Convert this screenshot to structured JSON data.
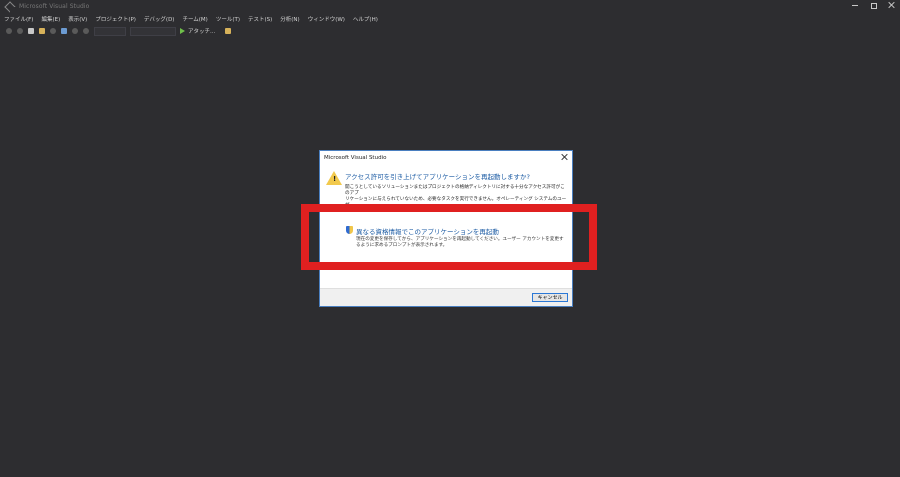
{
  "app": {
    "title": "Microsoft Visual Studio",
    "logo_icon": "visual-studio-logo",
    "window_controls": [
      "minimize-icon",
      "restore-icon",
      "close-icon"
    ]
  },
  "menu": {
    "items": [
      "ファイル(F)",
      "編集(E)",
      "表示(V)",
      "プロジェクト(P)",
      "デバッグ(D)",
      "チーム(M)",
      "ツール(T)",
      "テスト(S)",
      "分析(N)",
      "ウィンドウ(W)",
      "ヘルプ(H)"
    ]
  },
  "toolbar": {
    "attach_label": "アタッチ...",
    "attach_icon": "play-icon"
  },
  "dialog": {
    "title": "Microsoft Visual Studio",
    "icon": "warning-icon",
    "main_instruction": "アクセス許可を引き上げてアプリケーションを再起動しますか?",
    "content_line1": "開こうとしているソリューションまたはプロジェクトの格納ディレクトリに対する十分なアクセス許可がこのアプ",
    "content_line2": "リケーションに与えられていないため、必要なタスクを実行できません。オペレーティング システムのユーザ",
    "content_line3": "",
    "command1_icon": "shield-icon",
    "command1_title": "異なる資格情報でこのアプリケーションを再起動",
    "command1_desc1": "現在の変更を保存してから、アプリケーションを再起動してください。ユーザー アカウントを変更す",
    "command1_desc2": "るように求めるプロンプトが表示されます。",
    "command2_title": "",
    "command2_desc": "",
    "cancel_label": "キャンセル"
  },
  "colors": {
    "background": "#2d2d30",
    "dialog_accent": "#1a5aa3",
    "highlight": "#e02020"
  }
}
